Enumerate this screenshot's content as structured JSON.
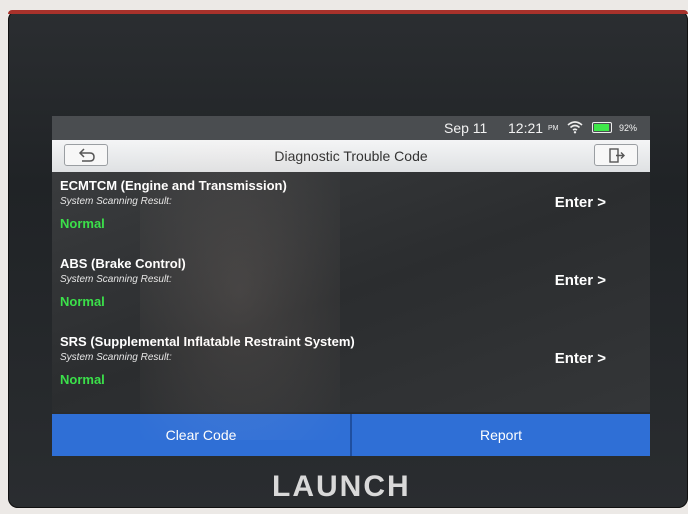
{
  "status_bar": {
    "date": "Sep 11",
    "time": "12:21",
    "ampm": "PM",
    "battery_percent": "92%",
    "battery_level": 0.92,
    "icons": [
      "wifi-icon",
      "battery-icon"
    ]
  },
  "header": {
    "title": "Diagnostic Trouble Code",
    "back_icon": "back-arrow-icon",
    "exit_icon": "exit-icon"
  },
  "systems": [
    {
      "name": "ECMTCM (Engine and Transmission)",
      "scan_label": "System Scanning Result:",
      "result": "Normal",
      "action": "Enter >"
    },
    {
      "name": "ABS (Brake Control)",
      "scan_label": "System Scanning Result:",
      "result": "Normal",
      "action": "Enter >"
    },
    {
      "name": "SRS (Supplemental Inflatable Restraint System)",
      "scan_label": "System Scanning Result:",
      "result": "Normal",
      "action": "Enter >"
    }
  ],
  "footer": {
    "clear_code_label": "Clear Code",
    "report_label": "Report"
  },
  "brand": "LAUNCH",
  "colors": {
    "accent_blue": "#2f6fd6",
    "normal_green": "#3be04a",
    "battery_green": "#3fe84a"
  }
}
